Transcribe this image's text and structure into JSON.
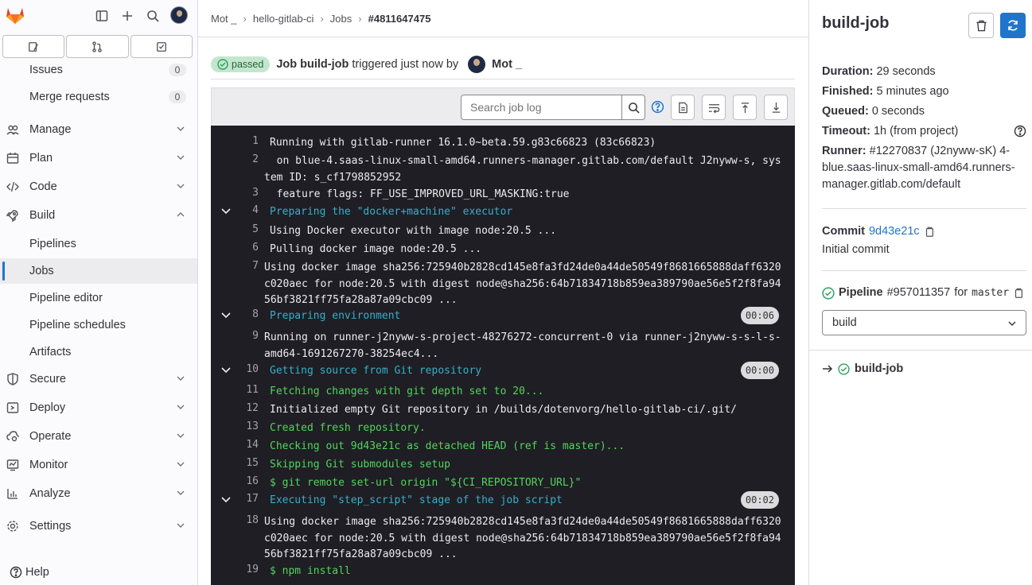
{
  "sidebar": {
    "top_icons": [
      "sidebar-toggle-icon",
      "plus-icon",
      "search-icon"
    ],
    "tabs": [
      "issues-tab-icon",
      "merge-requests-tab-icon",
      "todo-tab-icon"
    ],
    "items": [
      {
        "label": "Issues",
        "count": "0"
      },
      {
        "label": "Merge requests",
        "count": "0"
      },
      {
        "label": "Manage"
      },
      {
        "label": "Plan"
      },
      {
        "label": "Code"
      },
      {
        "label": "Build"
      },
      {
        "label": "Pipelines"
      },
      {
        "label": "Jobs"
      },
      {
        "label": "Pipeline editor"
      },
      {
        "label": "Pipeline schedules"
      },
      {
        "label": "Artifacts"
      },
      {
        "label": "Secure"
      },
      {
        "label": "Deploy"
      },
      {
        "label": "Operate"
      },
      {
        "label": "Monitor"
      },
      {
        "label": "Analyze"
      },
      {
        "label": "Settings"
      }
    ],
    "help": "Help"
  },
  "breadcrumb": [
    "Mot _",
    "hello-gitlab-ci",
    "Jobs",
    "#4811647475"
  ],
  "job_header": {
    "status": "passed",
    "prefix": "Job",
    "job_name": "build-job",
    "middle": "triggered just now by",
    "user": "Mot _"
  },
  "log_toolbar": {
    "search_placeholder": "Search job log"
  },
  "log_lines": [
    {
      "n": "1",
      "text": "Running with gitlab-runner 16.1.0~beta.59.g83c66823 (83c66823)"
    },
    {
      "n": "2",
      "text": "  on blue-4.saas-linux-small-amd64.runners-manager.gitlab.com/default J2nyww-s, system ID: s_cf1798852952"
    },
    {
      "n": "3",
      "text": "  feature flags: FF_USE_IMPROVED_URL_MASKING:true"
    },
    {
      "n": "4",
      "text": "Preparing the \"docker+machine\" executor"
    },
    {
      "n": "5",
      "text": "Using Docker executor with image node:20.5 ..."
    },
    {
      "n": "6",
      "text": "Pulling docker image node:20.5 ..."
    },
    {
      "n": "7",
      "text": "Using docker image sha256:725940b2828cd145e8fa3fd24de0a44de50549f8681665888daff6320c020aec for node:20.5 with digest node@sha256:64b71834718b859ea389790ae56e5f2f8fa9456bf3821ff75fa28a87a09cbc09 ..."
    },
    {
      "n": "8",
      "text": "Preparing environment",
      "duration": "00:06"
    },
    {
      "n": "9",
      "text": "Running on runner-j2nyww-s-project-48276272-concurrent-0 via runner-j2nyww-s-s-l-s-amd64-1691267270-38254ec4..."
    },
    {
      "n": "10",
      "text": "Getting source from Git repository",
      "duration": "00:00"
    },
    {
      "n": "11",
      "text": "Fetching changes with git depth set to 20..."
    },
    {
      "n": "12",
      "text": "Initialized empty Git repository in /builds/dotenvorg/hello-gitlab-ci/.git/"
    },
    {
      "n": "13",
      "text": "Created fresh repository."
    },
    {
      "n": "14",
      "text": "Checking out 9d43e21c as detached HEAD (ref is master)..."
    },
    {
      "n": "15",
      "text": "Skipping Git submodules setup"
    },
    {
      "n": "16",
      "text": "$ git remote set-url origin \"${CI_REPOSITORY_URL}\""
    },
    {
      "n": "17",
      "text": "Executing \"step_script\" stage of the job script",
      "duration": "00:02"
    },
    {
      "n": "18",
      "text": "Using docker image sha256:725940b2828cd145e8fa3fd24de0a44de50549f8681665888daff6320c020aec for node:20.5 with digest node@sha256:64b71834718b859ea389790ae56e5f2f8fa9456bf3821ff75fa28a87a09cbc09 ..."
    },
    {
      "n": "19",
      "text": "$ npm install"
    }
  ],
  "right_panel": {
    "title": "build-job",
    "duration_label": "Duration:",
    "duration": "29 seconds",
    "finished_label": "Finished:",
    "finished": "5 minutes ago",
    "queued_label": "Queued:",
    "queued": "0 seconds",
    "timeout_label": "Timeout:",
    "timeout": "1h (from project)",
    "runner_label": "Runner:",
    "runner": "#12270837 (J2nyww-sK) 4-blue.saas-linux-small-amd64.runners-manager.gitlab.com/default",
    "commit_label": "Commit",
    "commit_sha": "9d43e21c",
    "commit_message": "Initial commit",
    "pipeline_label": "Pipeline",
    "pipeline_id": "#957011357",
    "pipeline_for": "for",
    "pipeline_ref": "master",
    "stage_select": "build",
    "job_item": "build-job"
  }
}
